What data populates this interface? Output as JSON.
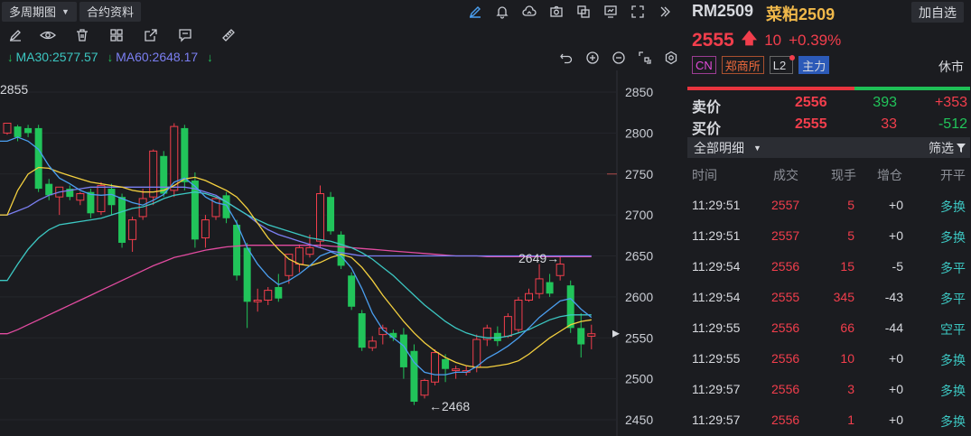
{
  "toolbar": {
    "period_label": "多周期图",
    "contract_info_label": "合约资料"
  },
  "indicators": {
    "ma30_label": "MA30:2577.57",
    "ma60_label": "MA60:2648.17"
  },
  "chart_data": {
    "type": "candlestick",
    "y_ticks": [
      2850,
      2800,
      2750,
      2700,
      2650,
      2600,
      2550,
      2500,
      2450
    ],
    "ylim": [
      2437,
      2870
    ],
    "annotations": {
      "top_left": "2855",
      "high_label": "2649→",
      "high_value": 2649,
      "low_label": "←2468",
      "low_value": 2468,
      "last_price": 2555
    },
    "candles": [
      {
        "o": 2800,
        "h": 2812,
        "c": 2812,
        "l": 2798
      },
      {
        "o": 2808,
        "h": 2810,
        "c": 2795,
        "l": 2790
      },
      {
        "o": 2806,
        "h": 2810,
        "c": 2800,
        "l": 2795
      },
      {
        "o": 2806,
        "h": 2810,
        "c": 2732,
        "l": 2728
      },
      {
        "o": 2738,
        "h": 2744,
        "c": 2724,
        "l": 2718
      },
      {
        "o": 2722,
        "h": 2734,
        "c": 2734,
        "l": 2700
      },
      {
        "o": 2732,
        "h": 2736,
        "c": 2722,
        "l": 2718
      },
      {
        "o": 2718,
        "h": 2728,
        "c": 2726,
        "l": 2712
      },
      {
        "o": 2728,
        "h": 2732,
        "c": 2702,
        "l": 2696
      },
      {
        "o": 2704,
        "h": 2740,
        "c": 2736,
        "l": 2700
      },
      {
        "o": 2732,
        "h": 2738,
        "c": 2712,
        "l": 2700
      },
      {
        "o": 2722,
        "h": 2726,
        "c": 2666,
        "l": 2660
      },
      {
        "o": 2670,
        "h": 2698,
        "c": 2694,
        "l": 2655
      },
      {
        "o": 2698,
        "h": 2732,
        "c": 2720,
        "l": 2694
      },
      {
        "o": 2722,
        "h": 2780,
        "c": 2778,
        "l": 2712
      },
      {
        "o": 2772,
        "h": 2778,
        "c": 2726,
        "l": 2722
      },
      {
        "o": 2730,
        "h": 2812,
        "c": 2808,
        "l": 2722
      },
      {
        "o": 2806,
        "h": 2810,
        "c": 2740,
        "l": 2730
      },
      {
        "o": 2742,
        "h": 2752,
        "c": 2670,
        "l": 2660
      },
      {
        "o": 2672,
        "h": 2700,
        "c": 2694,
        "l": 2660
      },
      {
        "o": 2698,
        "h": 2722,
        "c": 2720,
        "l": 2694
      },
      {
        "o": 2724,
        "h": 2728,
        "c": 2696,
        "l": 2690
      },
      {
        "o": 2688,
        "h": 2694,
        "c": 2626,
        "l": 2620
      },
      {
        "o": 2660,
        "h": 2666,
        "c": 2594,
        "l": 2562
      },
      {
        "o": 2594,
        "h": 2610,
        "c": 2596,
        "l": 2582
      },
      {
        "o": 2596,
        "h": 2612,
        "c": 2608,
        "l": 2590
      },
      {
        "o": 2612,
        "h": 2628,
        "c": 2598,
        "l": 2594
      },
      {
        "o": 2626,
        "h": 2650,
        "c": 2652,
        "l": 2616
      },
      {
        "o": 2640,
        "h": 2664,
        "c": 2660,
        "l": 2630
      },
      {
        "o": 2652,
        "h": 2676,
        "c": 2660,
        "l": 2648
      },
      {
        "o": 2668,
        "h": 2736,
        "c": 2726,
        "l": 2660
      },
      {
        "o": 2722,
        "h": 2728,
        "c": 2680,
        "l": 2676
      },
      {
        "o": 2676,
        "h": 2680,
        "c": 2638,
        "l": 2634
      },
      {
        "o": 2626,
        "h": 2630,
        "c": 2588,
        "l": 2584
      },
      {
        "o": 2580,
        "h": 2584,
        "c": 2538,
        "l": 2534
      },
      {
        "o": 2538,
        "h": 2552,
        "c": 2546,
        "l": 2534
      },
      {
        "o": 2554,
        "h": 2566,
        "c": 2562,
        "l": 2542
      },
      {
        "o": 2556,
        "h": 2560,
        "c": 2550,
        "l": 2546
      },
      {
        "o": 2554,
        "h": 2562,
        "c": 2514,
        "l": 2500
      },
      {
        "o": 2534,
        "h": 2542,
        "c": 2472,
        "l": 2468
      },
      {
        "o": 2480,
        "h": 2500,
        "c": 2498,
        "l": 2476
      },
      {
        "o": 2496,
        "h": 2536,
        "c": 2532,
        "l": 2492
      },
      {
        "o": 2524,
        "h": 2530,
        "c": 2512,
        "l": 2496
      },
      {
        "o": 2510,
        "h": 2516,
        "c": 2512,
        "l": 2500
      },
      {
        "o": 2508,
        "h": 2516,
        "c": 2510,
        "l": 2504
      },
      {
        "o": 2514,
        "h": 2554,
        "c": 2548,
        "l": 2508
      },
      {
        "o": 2548,
        "h": 2566,
        "c": 2562,
        "l": 2540
      },
      {
        "o": 2556,
        "h": 2564,
        "c": 2546,
        "l": 2540
      },
      {
        "o": 2552,
        "h": 2580,
        "c": 2576,
        "l": 2550
      },
      {
        "o": 2560,
        "h": 2600,
        "c": 2596,
        "l": 2556
      },
      {
        "o": 2596,
        "h": 2610,
        "c": 2604,
        "l": 2594
      },
      {
        "o": 2604,
        "h": 2640,
        "c": 2622,
        "l": 2598
      },
      {
        "o": 2618,
        "h": 2628,
        "c": 2604,
        "l": 2600
      },
      {
        "o": 2626,
        "h": 2649,
        "c": 2640,
        "l": 2620
      },
      {
        "o": 2614,
        "h": 2620,
        "c": 2562,
        "l": 2556
      },
      {
        "o": 2562,
        "h": 2580,
        "c": 2542,
        "l": 2526
      },
      {
        "o": 2552,
        "h": 2566,
        "c": 2555,
        "l": 2536
      }
    ],
    "ma_fast": [
      2790,
      2795,
      2790,
      2780,
      2760,
      2745,
      2738,
      2730,
      2725,
      2724,
      2725,
      2720,
      2715,
      2712,
      2718,
      2725,
      2740,
      2745,
      2735,
      2722,
      2715,
      2712,
      2690,
      2660,
      2640,
      2625,
      2615,
      2620,
      2628,
      2638,
      2650,
      2655,
      2650,
      2635,
      2610,
      2580,
      2560,
      2550,
      2540,
      2520,
      2508,
      2505,
      2505,
      2508,
      2508,
      2515,
      2525,
      2532,
      2540,
      2550,
      2562,
      2575,
      2585,
      2595,
      2598,
      2585,
      2575
    ],
    "ma_mid": [
      2700,
      2730,
      2750,
      2758,
      2757,
      2752,
      2748,
      2744,
      2740,
      2738,
      2736,
      2734,
      2730,
      2728,
      2728,
      2730,
      2736,
      2744,
      2746,
      2742,
      2736,
      2730,
      2722,
      2708,
      2690,
      2672,
      2658,
      2646,
      2640,
      2638,
      2642,
      2648,
      2652,
      2648,
      2636,
      2620,
      2602,
      2586,
      2570,
      2556,
      2544,
      2534,
      2526,
      2520,
      2516,
      2514,
      2514,
      2516,
      2518,
      2522,
      2530,
      2540,
      2550,
      2558,
      2566,
      2570,
      2572
    ],
    "ma30": [
      2620,
      2640,
      2658,
      2672,
      2682,
      2688,
      2690,
      2692,
      2694,
      2696,
      2700,
      2704,
      2708,
      2710,
      2714,
      2720,
      2724,
      2726,
      2728,
      2726,
      2722,
      2716,
      2708,
      2700,
      2694,
      2688,
      2684,
      2680,
      2676,
      2672,
      2670,
      2668,
      2664,
      2660,
      2654,
      2646,
      2636,
      2626,
      2614,
      2602,
      2590,
      2580,
      2570,
      2562,
      2556,
      2552,
      2550,
      2550,
      2552,
      2556,
      2560,
      2566,
      2572,
      2576,
      2578,
      2578,
      2578
    ],
    "ma60": [
      2700,
      2705,
      2710,
      2718,
      2724,
      2728,
      2730,
      2732,
      2734,
      2734,
      2734,
      2734,
      2734,
      2734,
      2734,
      2734,
      2734,
      2734,
      2732,
      2728,
      2724,
      2716,
      2708,
      2700,
      2690,
      2682,
      2676,
      2672,
      2668,
      2664,
      2660,
      2656,
      2654,
      2652,
      2650,
      2650,
      2650,
      2650,
      2650,
      2650,
      2650,
      2650,
      2650,
      2650,
      2650,
      2650,
      2650,
      2650,
      2650,
      2650,
      2650,
      2650,
      2650,
      2650,
      2650,
      2650,
      2650
    ],
    "ma_long": [
      2555,
      2560,
      2566,
      2572,
      2578,
      2584,
      2590,
      2596,
      2602,
      2608,
      2614,
      2620,
      2626,
      2632,
      2638,
      2643,
      2648,
      2651,
      2654,
      2657,
      2659,
      2661,
      2662,
      2663,
      2663,
      2663,
      2663,
      2663,
      2663,
      2663,
      2663,
      2662,
      2661,
      2660,
      2659,
      2658,
      2657,
      2656,
      2655,
      2654,
      2653,
      2652,
      2651,
      2650,
      2650,
      2650,
      2649,
      2649,
      2649,
      2649,
      2649,
      2649,
      2649,
      2649,
      2649,
      2649,
      2649
    ]
  },
  "right_panel": {
    "symbol_code": "RM2509",
    "symbol_name": "菜粕2509",
    "add_button": "加自选",
    "last_price": "2555",
    "change": "10",
    "change_pct": "+0.39%",
    "tags": {
      "cn": "CN",
      "exchange": "郑商所",
      "l2": "L2",
      "main": "主力"
    },
    "status": "休市",
    "ask": {
      "label": "卖价",
      "price": "2556",
      "volume": "393",
      "delta": "+353"
    },
    "bid": {
      "label": "买价",
      "price": "2555",
      "volume": "33",
      "delta": "-512"
    },
    "filter_select": "全部明细",
    "filter_button": "筛选",
    "tick_headers": {
      "time": "时间",
      "price": "成交",
      "volume": "现手",
      "oi": "增仓",
      "type": "开平"
    },
    "ticks": [
      {
        "time": "11:29:51",
        "price": "2557",
        "volume": "5",
        "oi": "+0",
        "type": "多换"
      },
      {
        "time": "11:29:51",
        "price": "2557",
        "volume": "5",
        "oi": "+0",
        "type": "多换"
      },
      {
        "time": "11:29:54",
        "price": "2556",
        "volume": "15",
        "oi": "-5",
        "type": "多平"
      },
      {
        "time": "11:29:54",
        "price": "2555",
        "volume": "345",
        "oi": "-43",
        "type": "多平"
      },
      {
        "time": "11:29:55",
        "price": "2556",
        "volume": "66",
        "oi": "-44",
        "type": "空平"
      },
      {
        "time": "11:29:55",
        "price": "2556",
        "volume": "10",
        "oi": "+0",
        "type": "多换"
      },
      {
        "time": "11:29:57",
        "price": "2556",
        "volume": "3",
        "oi": "+0",
        "type": "多换"
      },
      {
        "time": "11:29:57",
        "price": "2556",
        "volume": "1",
        "oi": "+0",
        "type": "多换"
      }
    ]
  },
  "colors": {
    "up": "#f23e4c",
    "down": "#21c45a",
    "ma_fast": "#4b9ff0",
    "ma_mid": "#f4d03f",
    "ma30": "#3cc7c2",
    "ma60": "#7b7ff2",
    "ma_long": "#e24ba0"
  }
}
